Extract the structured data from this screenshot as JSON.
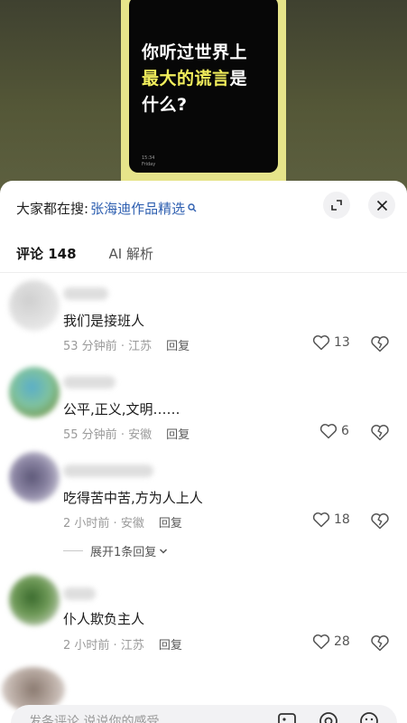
{
  "video": {
    "lines": [
      {
        "a": "你听过世界上",
        "hl": ""
      },
      {
        "a": "",
        "hl": "最大的谎言",
        "b": "是"
      },
      {
        "a": "什么?",
        "hl": ""
      }
    ],
    "small_text_1": "15:34",
    "small_text_2": "Friday"
  },
  "header": {
    "search_prefix": "大家都在搜:",
    "search_term": "张海迪作品精选",
    "tabs": [
      {
        "label": "评论 148",
        "active": true
      },
      {
        "label": "AI 解析",
        "active": false
      }
    ]
  },
  "comments": [
    {
      "text": "我们是接班人",
      "time": "53 分钟前",
      "location": "江苏",
      "reply": "回复",
      "likes": "13"
    },
    {
      "text": "公平,正义,文明……",
      "time": "55 分钟前",
      "location": "安徽",
      "reply": "回复",
      "likes": "6"
    },
    {
      "text": "吃得苦中苦,方为人上人",
      "time": "2 小时前",
      "location": "安徽",
      "reply": "回复",
      "likes": "18"
    },
    {
      "text": "仆人欺负主人",
      "time": "2 小时前",
      "location": "江苏",
      "reply": "回复",
      "likes": "28"
    }
  ],
  "expand_replies": "展开1条回复",
  "input": {
    "placeholder": "发条评论,说说你的感受"
  },
  "colors": {
    "search_link": "#2e5fb0",
    "highlight": "#f2ee5c",
    "frame": "#e6e48a"
  }
}
